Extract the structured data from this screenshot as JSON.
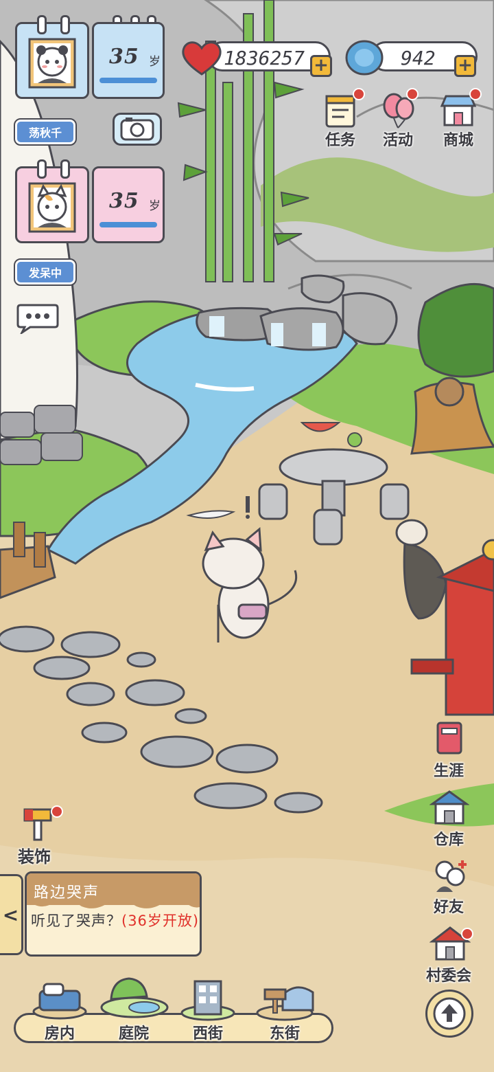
{
  "player1": {
    "age": "35",
    "age_unit": "岁",
    "status": "荡秋千",
    "age_bar_fraction": 0.95
  },
  "player2": {
    "age": "35",
    "age_unit": "岁",
    "status": "发呆中",
    "age_bar_fraction": 0.95
  },
  "resources": {
    "hearts": "1836257",
    "gems": "942",
    "add_symbol": "+"
  },
  "top_menu": [
    {
      "label": "任务",
      "icon": "calendar-icon"
    },
    {
      "label": "活动",
      "icon": "balloon-icon"
    },
    {
      "label": "商城",
      "icon": "shop-icon"
    }
  ],
  "side_menu": [
    {
      "label": "生涯",
      "icon": "book-icon"
    },
    {
      "label": "仓库",
      "icon": "warehouse-icon"
    },
    {
      "label": "好友",
      "icon": "friends-icon"
    },
    {
      "label": "村委会",
      "icon": "village-hall-icon"
    }
  ],
  "decorate": {
    "label": "装饰",
    "icon": "paint-brush-icon"
  },
  "event": {
    "title": "路边哭声",
    "text": "听见了哭声？",
    "highlight": "(36岁开放)",
    "collapse_symbol": "<"
  },
  "bottom_nav": [
    {
      "label": "房内",
      "icon": "bed-icon"
    },
    {
      "label": "庭院",
      "icon": "garden-icon"
    },
    {
      "label": "西街",
      "icon": "building-icon"
    },
    {
      "label": "东街",
      "icon": "signpost-icon"
    }
  ],
  "colors": {
    "accent_blue": "#5c8fd3",
    "notify_red": "#d8453c",
    "plus_yellow": "#f2b93a",
    "highlight_red": "#e0302a"
  }
}
